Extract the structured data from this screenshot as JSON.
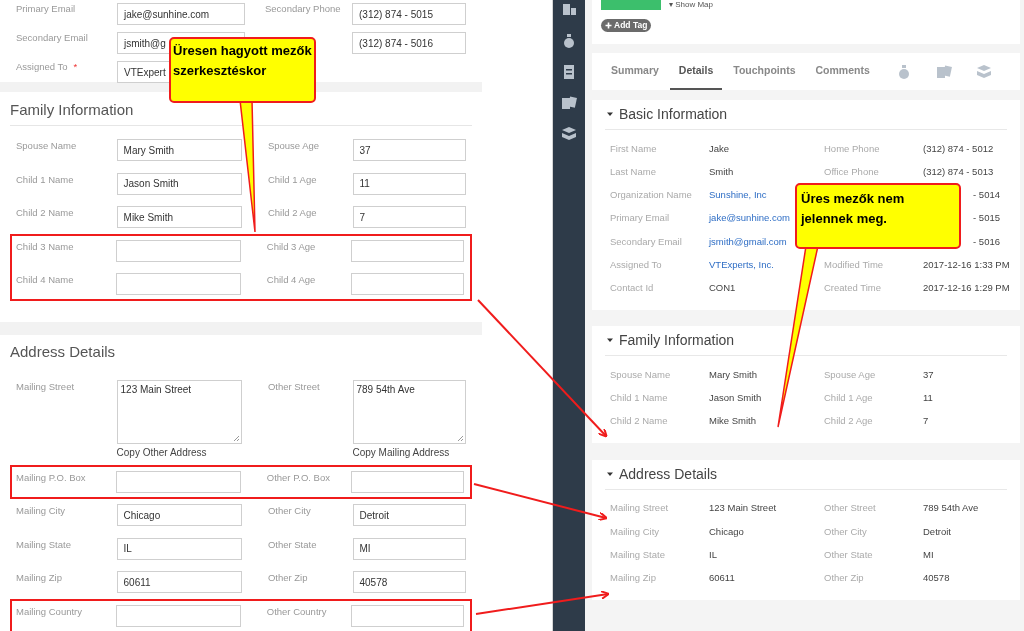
{
  "edit_form": {
    "top_rows": [
      {
        "label": "Primary Email",
        "value": "jake@sunhine.com",
        "right_label": "Secondary Phone",
        "right_value": "(312) 874 - 5015"
      },
      {
        "label": "Secondary Email",
        "value": "jsmith@g",
        "right_value": "(312) 874 - 5016"
      },
      {
        "label": "Assigned To",
        "required_mark": "*",
        "value": "VTExpert"
      }
    ],
    "sections": [
      {
        "title": "Family Information",
        "rows": [
          {
            "kind": "input",
            "highlighted": false,
            "label": "Spouse Name",
            "value": "Mary Smith",
            "right_label": "Spouse Age",
            "right_value": "37"
          },
          {
            "kind": "input",
            "highlighted": false,
            "label": "Child 1 Name",
            "value": "Jason Smith",
            "right_label": "Child 1 Age",
            "right_value": "11"
          },
          {
            "kind": "input",
            "highlighted": false,
            "label": "Child 2 Name",
            "value": "Mike Smith",
            "right_label": "Child 2 Age",
            "right_value": "7"
          },
          {
            "kind": "input",
            "highlighted": true,
            "label": "Child 3 Name",
            "right_label": "Child 3 Age"
          },
          {
            "kind": "input",
            "highlighted": true,
            "label": "Child 4 Name",
            "right_label": "Child 4 Age"
          }
        ]
      },
      {
        "title": "Address Details",
        "rows": [
          {
            "kind": "textarea",
            "highlighted": false,
            "label": "Mailing Street",
            "value": "123 Main Street",
            "action": "Copy Other Address",
            "right_label": "Other Street",
            "right_value": "789 54th Ave",
            "right_action": "Copy Mailing Address"
          },
          {
            "kind": "input",
            "highlighted": true,
            "label": "Mailing P.O. Box",
            "right_label": "Other P.O. Box"
          },
          {
            "kind": "input",
            "highlighted": false,
            "label": "Mailing City",
            "value": "Chicago",
            "right_label": "Other City",
            "right_value": "Detroit"
          },
          {
            "kind": "input",
            "highlighted": false,
            "label": "Mailing State",
            "value": "IL",
            "right_label": "Other State",
            "right_value": "MI"
          },
          {
            "kind": "input",
            "highlighted": false,
            "label": "Mailing Zip",
            "value": "60611",
            "right_label": "Other Zip",
            "right_value": "40578"
          },
          {
            "kind": "input",
            "highlighted": true,
            "label": "Mailing Country",
            "right_label": "Other Country"
          }
        ]
      }
    ]
  },
  "detail_view": {
    "show_map": "▾ Show Map",
    "add_tag": "Add Tag",
    "tabs": [
      {
        "label": "Summary",
        "selected": false
      },
      {
        "label": "Details",
        "selected": true
      },
      {
        "label": "Touchpoints",
        "selected": false
      },
      {
        "label": "Comments",
        "selected": false
      }
    ],
    "sections": [
      {
        "title": "Basic Information",
        "expanded": true,
        "rows": [
          {
            "label": "First Name",
            "value": "Jake",
            "right_label": "Home Phone",
            "right_value": "(312) 874 - 5012"
          },
          {
            "label": "Last Name",
            "value": "Smith",
            "right_label": "Office Phone",
            "right_value": "(312) 874 - 5013"
          },
          {
            "label": "Organization Name",
            "value": "Sunshine, Inc",
            "link": true,
            "right_value": "- 5014"
          },
          {
            "label": "Primary Email",
            "value": "jake@sunhine.com",
            "link": true,
            "right_value": "- 5015"
          },
          {
            "label": "Secondary Email",
            "value": "jsmith@gmail.com",
            "link": true,
            "right_value": "- 5016"
          },
          {
            "label": "Assigned To",
            "value": "VTExperts, Inc.",
            "link": true,
            "right_label": "Modified Time",
            "right_value": "2017-12-16 1:33 PM"
          },
          {
            "label": "Contact Id",
            "value": "CON1",
            "right_label": "Created Time",
            "right_value": "2017-12-16 1:29 PM"
          }
        ]
      },
      {
        "title": "Family Information",
        "expanded": true,
        "rows": [
          {
            "label": "Spouse Name",
            "value": "Mary Smith",
            "right_label": "Spouse Age",
            "right_value": "37"
          },
          {
            "label": "Child 1 Name",
            "value": "Jason Smith",
            "right_label": "Child 1 Age",
            "right_value": "11"
          },
          {
            "label": "Child 2 Name",
            "value": "Mike Smith",
            "right_label": "Child 2 Age",
            "right_value": "7"
          }
        ]
      },
      {
        "title": "Address Details",
        "expanded": true,
        "rows": [
          {
            "label": "Mailing Street",
            "value": "123 Main Street",
            "right_label": "Other Street",
            "right_value": "789 54th Ave"
          },
          {
            "label": "Mailing City",
            "value": "Chicago",
            "right_label": "Other City",
            "right_value": "Detroit"
          },
          {
            "label": "Mailing State",
            "value": "IL",
            "right_label": "Other State",
            "right_value": "MI"
          },
          {
            "label": "Mailing Zip",
            "value": "60611",
            "right_label": "Other Zip",
            "right_value": "40578"
          }
        ]
      }
    ]
  },
  "callouts": [
    {
      "text": "Üresen hagyott mezők szerkesztéskor"
    },
    {
      "text": "Üres mezők nem jelennek meg."
    }
  ]
}
